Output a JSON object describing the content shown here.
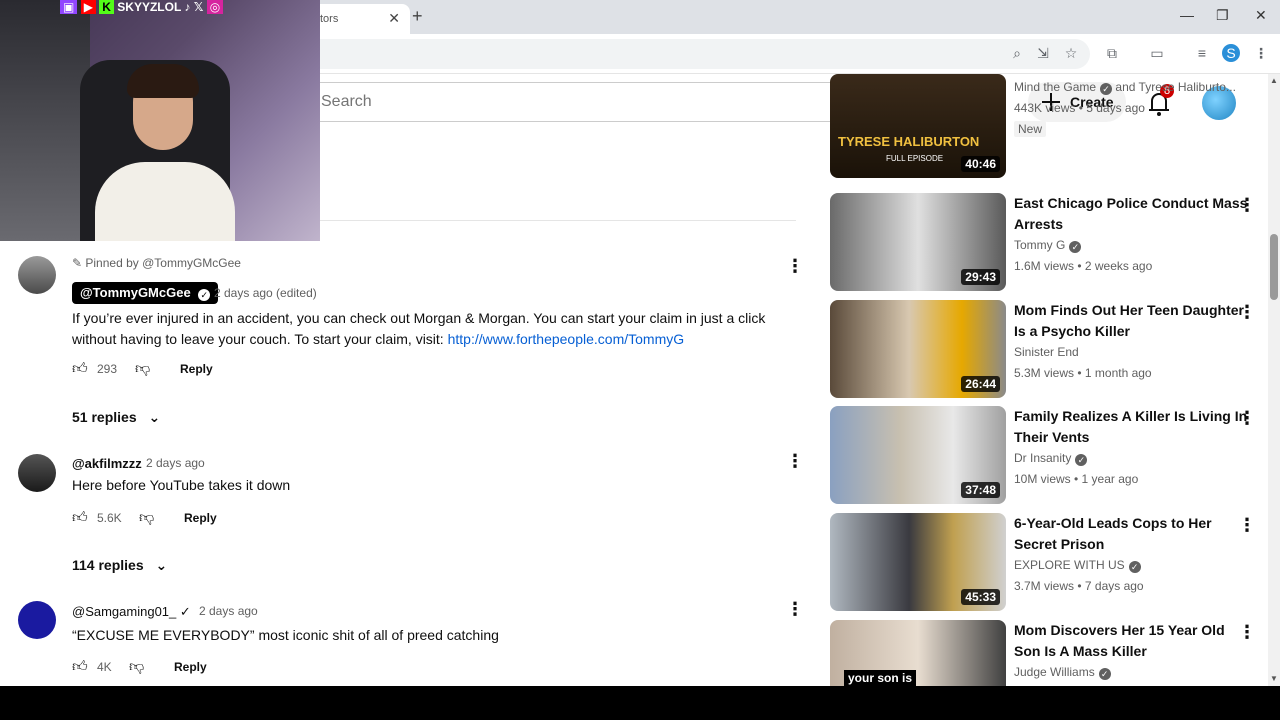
{
  "browser": {
    "tab_title": "tors",
    "tab_close": "✕",
    "new_tab": "+"
  },
  "masthead": {
    "search_placeholder": "Search",
    "create_label": "Create",
    "notification_count": "8"
  },
  "overlay": {
    "handle": "SKYYZLOL"
  },
  "comments": [
    {
      "pinned_by": "Pinned by @TommyGMcGee",
      "author": "@TommyGMcGee",
      "time": "2 days ago (edited)",
      "text": "If you’re ever injured in an accident, you can check out Morgan & Morgan. You can start your claim in just a click without having to leave your couch. To start your claim, visit: ",
      "link": "http://www.forthepeople.com/TommyG",
      "likes": "293",
      "reply_label": "Reply",
      "replies": "51 replies"
    },
    {
      "author": "@akfilmzzz",
      "time": "2 days ago",
      "text": "Here before YouTube takes it down",
      "likes": "5.6K",
      "reply_label": "Reply",
      "replies": "114 replies"
    },
    {
      "author": "@Samgaming01_",
      "time": "2 days ago",
      "text": "“EXCUSE ME EVERYBODY” most iconic shit of all of preed catching",
      "likes": "4K",
      "reply_label": "Reply"
    }
  ],
  "videos": [
    {
      "title": "",
      "channel": "Mind the Game",
      "channel2": "and Tyrese Haliburto...",
      "meta": "443K views • 5 days ago",
      "badge": "New",
      "duration": "40:46",
      "thumb_text": "TYRESE HALIBURTON",
      "thumb_sub": "FULL EPISODE"
    },
    {
      "title": "East Chicago Police Conduct Mass Arrests",
      "channel": "Tommy G",
      "meta": "1.6M views • 2 weeks ago",
      "duration": "29:43"
    },
    {
      "title": "Mom Finds Out Her Teen Daughter Is a Psycho Killer",
      "channel": "Sinister End",
      "meta": "5.3M views • 1 month ago",
      "duration": "26:44"
    },
    {
      "title": "Family Realizes A Killer Is Living In Their Vents",
      "channel": "Dr Insanity",
      "meta": "10M views • 1 year ago",
      "duration": "37:48"
    },
    {
      "title": "6-Year-Old Leads Cops to Her Secret Prison",
      "channel": "EXPLORE WITH US",
      "meta": "3.7M views • 7 days ago",
      "duration": "45:33"
    },
    {
      "title": "Mom Discovers Her 15 Year Old Son Is A Mass Killer",
      "channel": "Judge Williams",
      "meta": "",
      "duration": "",
      "thumb_text": "your son is"
    }
  ]
}
